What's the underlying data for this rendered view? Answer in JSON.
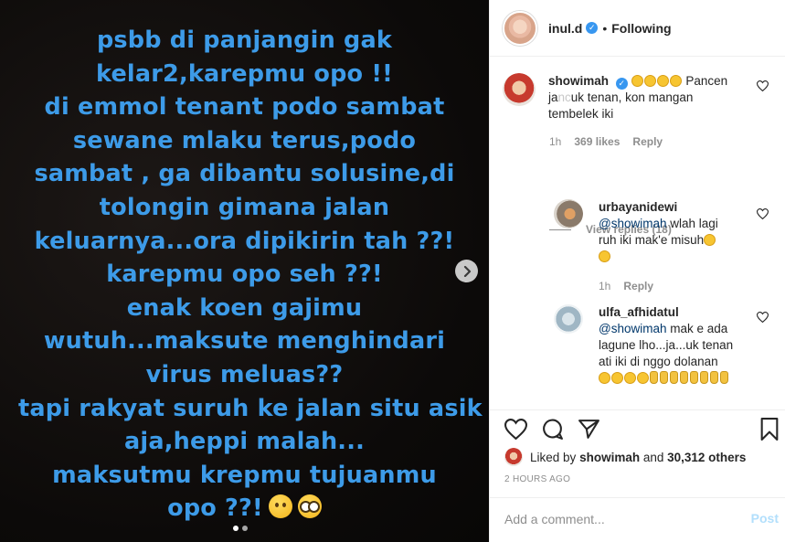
{
  "post": {
    "lines": [
      "psbb di panjangin gak",
      "kelar2,karepmu opo !!",
      "di emmol tenant podo sambat",
      "sewane mlaku terus,podo",
      "sambat , ga dibantu solusine,di",
      "tolongin gimana jalan",
      "keluarnya...ora dipikirin tah ??!",
      "karepmu opo seh ??!",
      "enak koen gajimu",
      "wutuh...maksute menghindari",
      "virus meluas??",
      "tapi rakyat suruh ke jalan situ asik",
      "aja,heppi malah...",
      "maksutmu krepmu tujuanmu",
      "opo ??!"
    ],
    "text_color": "#3d9be8",
    "emojis": [
      "upside-down-face-icon",
      "nerd-face-icon"
    ]
  },
  "header": {
    "username": "inul.d",
    "separator": "•",
    "follow_state": "Following"
  },
  "comments": [
    {
      "username": "showimah",
      "text": "Pancen ja...uk tenan, kon mangan tembelek iki",
      "text_part1": "Pancen",
      "text_part2": "ja",
      "text_part3": "uk tenan, kon mangan",
      "text_part4": "tembelek iki",
      "time": "1h",
      "likes": "369 likes",
      "reply_label": "Reply",
      "view_replies": "View replies (18)"
    },
    {
      "username": "urbayanidewi",
      "mention": "@showimah",
      "text": "wlah lagi ruh iki mak'e misuh",
      "text_part1": "wlah lagi",
      "text_part2": "ruh iki mak'e misuh",
      "time": "1h",
      "reply_label": "Reply"
    },
    {
      "username": "ulfa_afhidatul",
      "mention": "@showimah",
      "text_part1": "mak e ada",
      "text_part2": "lagune lho...ja...uk tenan",
      "text_part3": "ati iki di nggo dolanan"
    }
  ],
  "likes_summary": {
    "prefix": "Liked by",
    "user": "showimah",
    "joiner": "and",
    "count": "30,312 others"
  },
  "timestamp": "2 HOURS AGO",
  "composer": {
    "placeholder": "Add a comment...",
    "post_label": "Post"
  },
  "colors": {
    "link_blue": "#00376b",
    "verified_blue": "#3897f0",
    "muted_gray": "#8e8e8e",
    "post_disabled": "#b2dffc"
  }
}
